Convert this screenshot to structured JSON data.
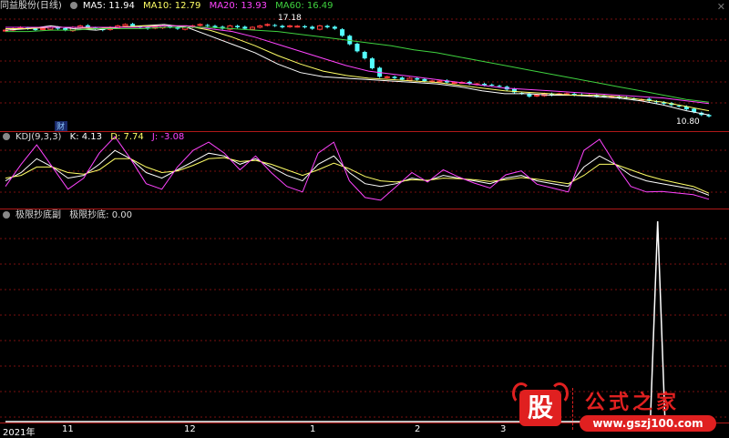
{
  "main_header": {
    "name": "同益股份(日线)",
    "ma5": "MA5: 11.94",
    "ma10": "MA10: 12.79",
    "ma20": "MA20: 13.93",
    "ma60": "MA60: 16.49"
  },
  "kdj_header": {
    "name": "KDJ(9,3,3)",
    "k": "K: 4.13",
    "d": "D: 7.74",
    "j": "J: -3.08"
  },
  "ind_header": {
    "name": "极限抄底副",
    "value": "极限抄底: 0.00"
  },
  "annotations": {
    "high_price": "17.18",
    "low_price": "10.80",
    "marker": "财",
    "close_btn": "✕"
  },
  "axis": {
    "labels": [
      "2021年",
      "11",
      "12",
      "1",
      "2",
      "3"
    ]
  },
  "watermark": {
    "logo_char": "股",
    "brand": "公式之家",
    "url": "www.gszj100.com"
  },
  "colors": {
    "up": "#ff3b3b",
    "down": "#54ffff",
    "ma5": "#ffffff",
    "ma10": "#ffff66",
    "ma20": "#ff44ff",
    "ma60": "#3fd23f",
    "grid": "#7a1010",
    "kdj_k": "#ffffff",
    "kdj_d": "#ffff66",
    "kdj_j": "#ff44ff"
  },
  "chart_data": [
    {
      "type": "line",
      "title": "同益股份(日线)",
      "note": "candlestick price panel with moving averages",
      "ylim": [
        10.4,
        18.0
      ],
      "series": [
        {
          "name": "close",
          "values": [
            16.9,
            17.0,
            17.1,
            17.0,
            16.9,
            17.0,
            17.1,
            17.0,
            16.9,
            17.1,
            17.2,
            17.1,
            17.0,
            16.9,
            17.1,
            17.2,
            17.3,
            17.2,
            17.1,
            17.0,
            17.1,
            17.2,
            17.1,
            17.0,
            17.1,
            17.2,
            17.3,
            17.2,
            17.1,
            17.0,
            17.2,
            17.1,
            17.0,
            17.1,
            17.2,
            17.3,
            17.2,
            17.1,
            17.2,
            17.18,
            17.1,
            17.0,
            17.2,
            17.1,
            17.0,
            16.5,
            15.9,
            15.4,
            14.9,
            14.2,
            13.6,
            13.6,
            13.5,
            13.4,
            13.5,
            13.4,
            13.3,
            13.3,
            13.3,
            13.2,
            13.2,
            13.2,
            13.1,
            13.1,
            13.0,
            13.0,
            12.9,
            12.7,
            12.5,
            12.4,
            12.2,
            12.3,
            12.4,
            12.3,
            12.4,
            12.4,
            12.3,
            12.3,
            12.3,
            12.2,
            12.2,
            12.2,
            12.1,
            12.1,
            12.0,
            12.0,
            11.9,
            11.8,
            11.7,
            11.6,
            11.5,
            11.3,
            11.1,
            10.9,
            10.8
          ]
        },
        {
          "name": "MA5",
          "values": [
            16.9,
            17.0,
            17.2,
            17.0,
            16.9,
            17.1,
            17.2,
            17.3,
            17.1,
            16.5,
            15.9,
            15.3,
            14.5,
            13.9,
            13.6,
            13.5,
            13.4,
            13.3,
            13.2,
            13.1,
            12.9,
            12.6,
            12.4,
            12.4,
            12.3,
            12.3,
            12.2,
            12.1,
            11.9,
            11.6,
            11.2,
            10.9
          ]
        },
        {
          "name": "MA10",
          "values": [
            17.0,
            17.0,
            17.1,
            17.1,
            17.0,
            17.1,
            17.2,
            17.2,
            17.2,
            16.9,
            16.4,
            15.8,
            15.1,
            14.5,
            14.0,
            13.7,
            13.5,
            13.4,
            13.3,
            13.2,
            13.0,
            12.8,
            12.6,
            12.5,
            12.4,
            12.3,
            12.3,
            12.2,
            12.0,
            11.8,
            11.5,
            11.2
          ]
        },
        {
          "name": "MA20",
          "values": [
            17.1,
            17.1,
            17.1,
            17.1,
            17.1,
            17.1,
            17.1,
            17.2,
            17.2,
            17.0,
            16.8,
            16.4,
            15.9,
            15.4,
            14.9,
            14.4,
            14.0,
            13.8,
            13.6,
            13.4,
            13.2,
            13.0,
            12.8,
            12.7,
            12.6,
            12.5,
            12.4,
            12.3,
            12.2,
            12.1,
            11.9,
            11.7
          ]
        },
        {
          "name": "MA60",
          "values": [
            16.8,
            16.8,
            16.9,
            16.9,
            17.0,
            17.0,
            17.0,
            17.1,
            17.1,
            17.1,
            17.0,
            16.9,
            16.8,
            16.6,
            16.4,
            16.2,
            16.0,
            15.8,
            15.5,
            15.3,
            15.0,
            14.7,
            14.4,
            14.1,
            13.8,
            13.5,
            13.2,
            12.9,
            12.6,
            12.3,
            12.0,
            11.8
          ]
        }
      ]
    },
    {
      "type": "line",
      "title": "KDJ(9,3,3)",
      "ylim": [
        -15,
        110
      ],
      "series": [
        {
          "name": "K",
          "values": [
            30,
            45,
            70,
            55,
            35,
            40,
            60,
            85,
            70,
            45,
            35,
            50,
            65,
            80,
            75,
            60,
            70,
            55,
            40,
            30,
            60,
            75,
            45,
            25,
            20,
            25,
            35,
            30,
            40,
            35,
            30,
            25,
            35,
            40,
            30,
            25,
            20,
            55,
            75,
            60,
            40,
            30,
            25,
            20,
            15,
            4.13
          ]
        },
        {
          "name": "D",
          "values": [
            35,
            40,
            55,
            55,
            45,
            42,
            50,
            70,
            70,
            55,
            45,
            48,
            58,
            70,
            72,
            65,
            67,
            60,
            50,
            40,
            50,
            62,
            52,
            38,
            30,
            28,
            32,
            31,
            35,
            34,
            32,
            29,
            32,
            36,
            33,
            29,
            25,
            40,
            60,
            60,
            50,
            40,
            32,
            26,
            20,
            7.74
          ]
        },
        {
          "name": "J",
          "values": [
            20,
            60,
            95,
            55,
            15,
            35,
            80,
            110,
            70,
            25,
            15,
            55,
            85,
            100,
            80,
            50,
            75,
            45,
            20,
            10,
            80,
            100,
            30,
            0,
            -5,
            20,
            45,
            28,
            50,
            37,
            26,
            17,
            41,
            48,
            24,
            17,
            10,
            85,
            105,
            60,
            20,
            10,
            11,
            8,
            5,
            -3.08
          ]
        }
      ]
    },
    {
      "type": "line",
      "title": "极限抄底副",
      "ylim": [
        0,
        1
      ],
      "series": [
        {
          "name": "极限抄底",
          "values": [
            0,
            0,
            0,
            0,
            0,
            0,
            0,
            0,
            0,
            0,
            0,
            0,
            0,
            0,
            0,
            0,
            0,
            0,
            0,
            0,
            0,
            0,
            0,
            0,
            0,
            0,
            0,
            0,
            0,
            0,
            0,
            0,
            0,
            0,
            0,
            0,
            0,
            0,
            0,
            0,
            0,
            0,
            0,
            0,
            0,
            0,
            0,
            0,
            0,
            0,
            0,
            0,
            0,
            0,
            0,
            0,
            0,
            0,
            0,
            0,
            0,
            0,
            0,
            0,
            0,
            0,
            0,
            0,
            0,
            0,
            0,
            0,
            0,
            0,
            0,
            0,
            0,
            0,
            0,
            0,
            0,
            0,
            0,
            0,
            0,
            0,
            0,
            0,
            0,
            1,
            0,
            0,
            0,
            0,
            0,
            0,
            0
          ]
        }
      ]
    }
  ]
}
